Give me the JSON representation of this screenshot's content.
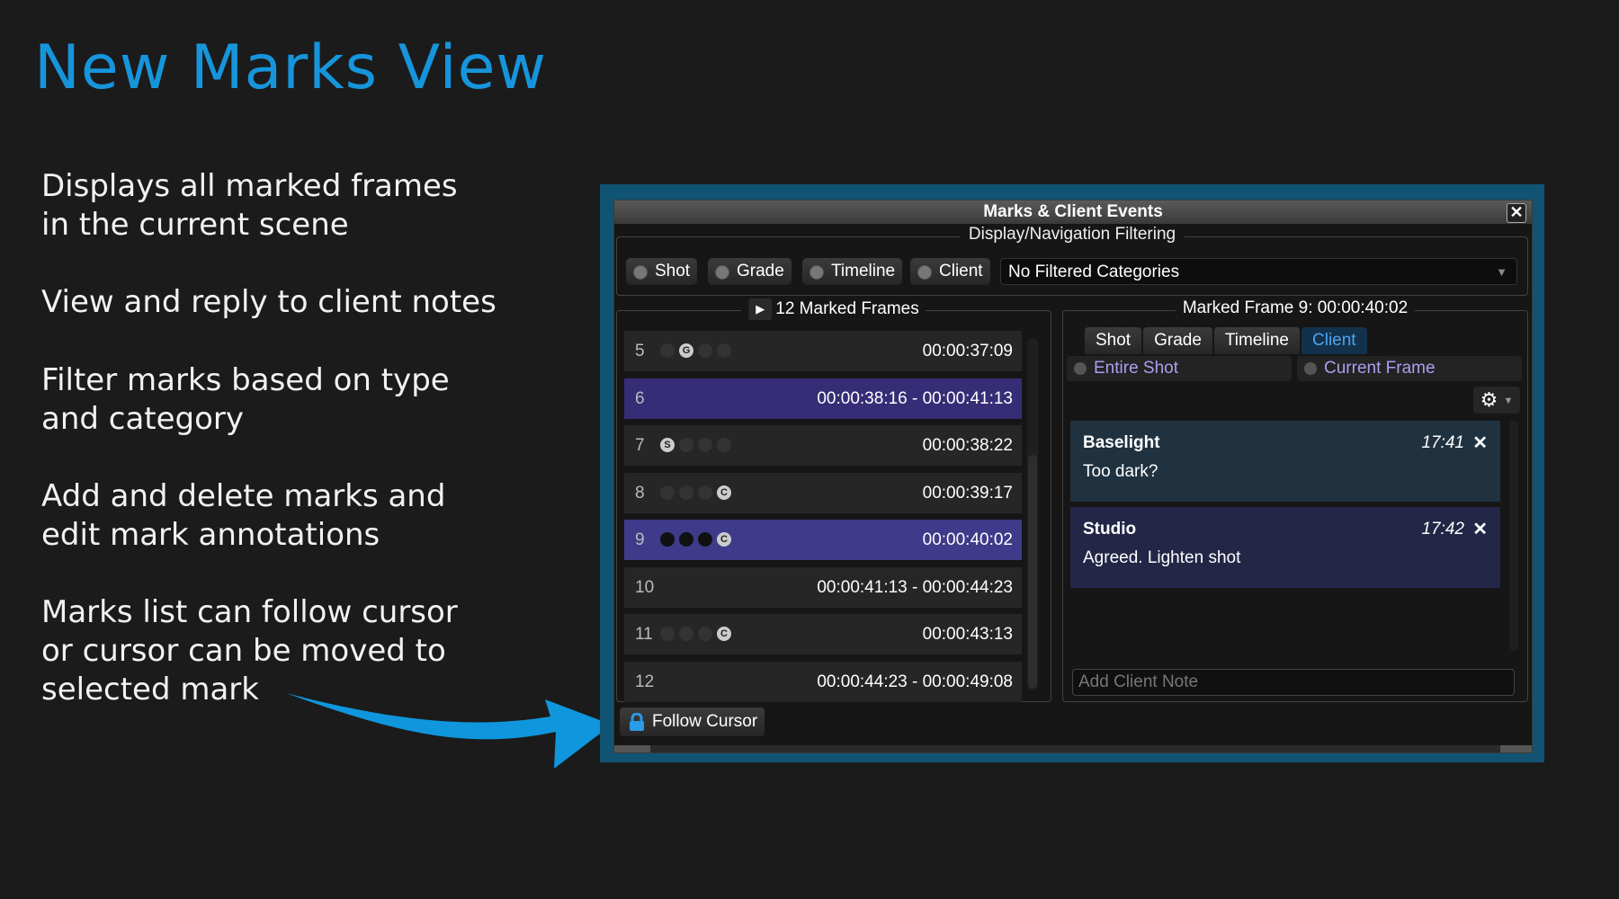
{
  "slide": {
    "title": "New Marks View",
    "bullets": [
      "Displays all marked frames\nin the current scene",
      "View and reply to client notes",
      "Filter marks based on type\nand category",
      "Add and delete marks and\nedit mark annotations",
      "Marks list can follow cursor\nor cursor can be moved to\nselected mark"
    ]
  },
  "window": {
    "title": "Marks & Client Events",
    "close_icon": "close-icon",
    "filtering": {
      "label": "Display/Navigation Filtering",
      "buttons": [
        "Shot",
        "Grade",
        "Timeline",
        "Client"
      ],
      "dropdown_value": "No Filtered Categories"
    },
    "list": {
      "header": "12 Marked Frames",
      "rows": [
        {
          "num": "5",
          "time": "00:00:37:09",
          "circles": [
            "",
            "G",
            "",
            ""
          ]
        },
        {
          "num": "6",
          "time": "00:00:38:16 - 00:00:41:13",
          "circles": []
        },
        {
          "num": "7",
          "time": "00:00:38:22",
          "circles": [
            "S",
            "",
            "",
            ""
          ]
        },
        {
          "num": "8",
          "time": "00:00:39:17",
          "circles": [
            "",
            "",
            "",
            "C"
          ]
        },
        {
          "num": "9",
          "time": "00:00:40:02",
          "circles": [
            "•",
            "•",
            "•",
            "C"
          ]
        },
        {
          "num": "10",
          "time": "00:00:41:13 - 00:00:44:23",
          "circles": []
        },
        {
          "num": "11",
          "time": "00:00:43:13",
          "circles": [
            "",
            "",
            "",
            "C"
          ]
        },
        {
          "num": "12",
          "time": "00:00:44:23 - 00:00:49:08",
          "circles": []
        }
      ]
    },
    "detail": {
      "header": "Marked Frame 9: 00:00:40:02",
      "tabs": [
        "Shot",
        "Grade",
        "Timeline",
        "Client"
      ],
      "active_tab": "Client",
      "scope_entire": "Entire Shot",
      "scope_current": "Current Frame",
      "notes": [
        {
          "author": "Baselight",
          "time": "17:41",
          "text": "Too dark?"
        },
        {
          "author": "Studio",
          "time": "17:42",
          "text": "Agreed. Lighten shot"
        }
      ],
      "add_placeholder": "Add Client Note"
    },
    "follow_label": "Follow Cursor"
  },
  "colors": {
    "accent": "#1695dc",
    "frame_border": "#115373",
    "selected_row": "#3f3a8a",
    "active_tab_text": "#4aa5ee"
  }
}
